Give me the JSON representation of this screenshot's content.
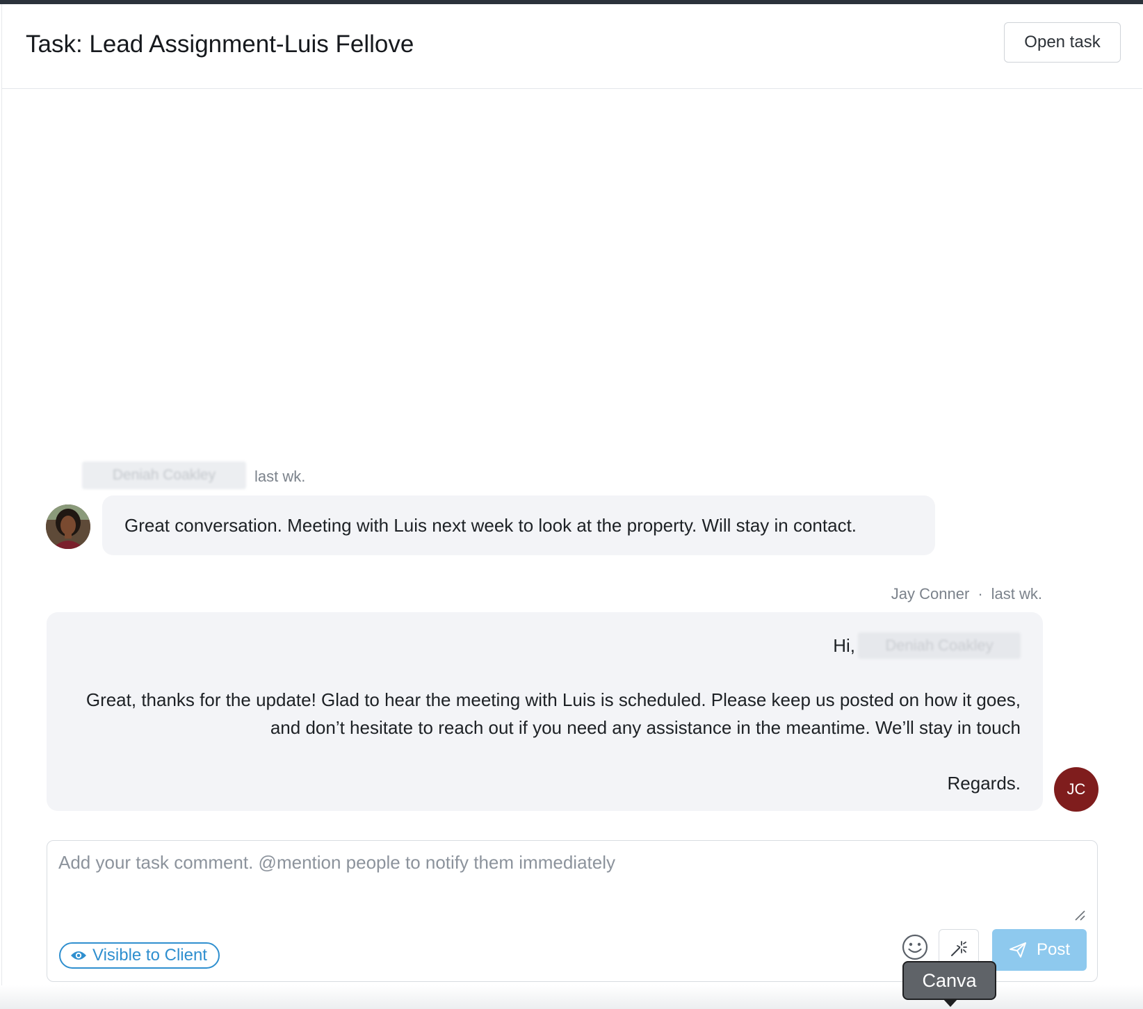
{
  "header": {
    "title": "Task: Lead Assignment-Luis Fellove",
    "open_task_label": "Open task"
  },
  "messages": [
    {
      "author": "Deniah Coakley",
      "time": "last wk.",
      "text": "Great conversation. Meeting with Luis next week to look at the property. Will stay in contact."
    },
    {
      "author": "Jay Conner",
      "separator": "·",
      "time": "last wk.",
      "greeting": "Hi,",
      "greeting_name": "Deniah Coakley",
      "body": "Great, thanks for the update! Glad to hear the meeting with Luis is scheduled. Please keep us posted on how it goes, and don’t hesitate to reach out if you need any assistance in the meantime. We’ll stay in touch",
      "closing": "Regards.",
      "avatar_initials": "JC"
    }
  ],
  "composer": {
    "placeholder": "Add your task comment. @mention people to notify them immediately",
    "value": "",
    "visibility_label": "Visible to Client",
    "post_label": "Post",
    "tooltip": "Canva"
  },
  "icons": {
    "visibility": "eye-icon",
    "emoji": "smiley-icon",
    "magic": "magic-wand-icon",
    "post": "paper-plane-icon",
    "resize": "resize-handle-icon"
  },
  "colors": {
    "accent": "#2f8fcf",
    "post_button": "#8ec9ee",
    "avatar_jc": "#7f1d1d",
    "bubble": "#f3f4f7"
  }
}
